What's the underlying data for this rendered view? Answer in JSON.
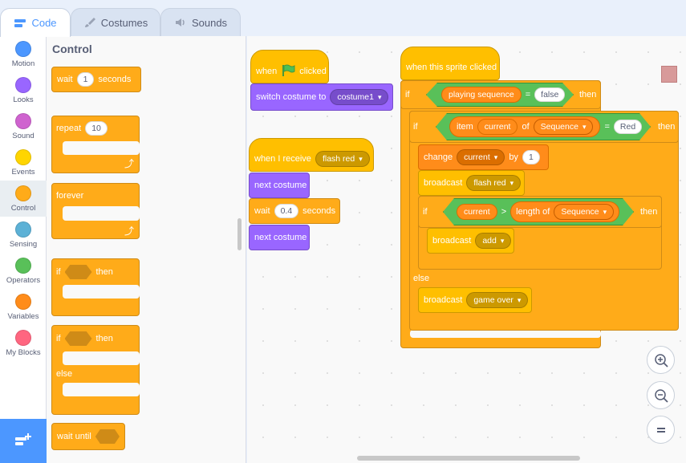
{
  "tabs": [
    {
      "label": "Code",
      "icon": "code-icon",
      "active": true
    },
    {
      "label": "Costumes",
      "icon": "brush-icon",
      "active": false
    },
    {
      "label": "Sounds",
      "icon": "speaker-icon",
      "active": false
    }
  ],
  "categories": [
    {
      "label": "Motion",
      "color": "#4c97ff"
    },
    {
      "label": "Looks",
      "color": "#9966ff"
    },
    {
      "label": "Sound",
      "color": "#cf63cf"
    },
    {
      "label": "Events",
      "color": "#ffd500"
    },
    {
      "label": "Control",
      "color": "#ffab19"
    },
    {
      "label": "Sensing",
      "color": "#5cb1d6"
    },
    {
      "label": "Operators",
      "color": "#59c059"
    },
    {
      "label": "Variables",
      "color": "#ff8c1a"
    },
    {
      "label": "My Blocks",
      "color": "#ff6680"
    }
  ],
  "palette": {
    "title": "Control",
    "wait": {
      "label": "wait",
      "value": "1",
      "unit": "seconds"
    },
    "repeat": {
      "label": "repeat",
      "value": "10"
    },
    "forever": {
      "label": "forever"
    },
    "if_then": {
      "if": "if",
      "then": "then"
    },
    "if_else": {
      "if": "if",
      "then": "then",
      "else": "else"
    },
    "wait_until": {
      "label": "wait until"
    }
  },
  "scripts": {
    "flag": {
      "when": "when",
      "clicked": "clicked",
      "switch": "switch costume to",
      "costume": "costume1"
    },
    "receive": {
      "label": "when I receive",
      "message": "flash red",
      "next1": "next costume",
      "wait": "wait",
      "wait_value": "0.4",
      "wait_unit": "seconds",
      "next2": "next costume"
    },
    "sprite_clicked": {
      "hat": "when this sprite clicked",
      "if1": "if",
      "var_playing": "playing sequence",
      "eq1": "=",
      "val_false": "false",
      "then1": "then",
      "if2": "if",
      "item": "item",
      "var_current": "current",
      "of": "of",
      "list_sequence": "Sequence",
      "eq2": "=",
      "val_red": "Red",
      "then2": "then",
      "change": "change",
      "change_var": "current",
      "by": "by",
      "change_value": "1",
      "broadcast1": "broadcast",
      "msg1": "flash red",
      "if3": "if",
      "var_current2": "current",
      "gt": ">",
      "length_of": "length of",
      "list_sequence2": "Sequence",
      "then3": "then",
      "broadcast2": "broadcast",
      "msg2": "add",
      "else": "else",
      "broadcast3": "broadcast",
      "msg3": "game over"
    }
  },
  "zoom": {
    "in": "+",
    "out": "−",
    "reset": "="
  }
}
